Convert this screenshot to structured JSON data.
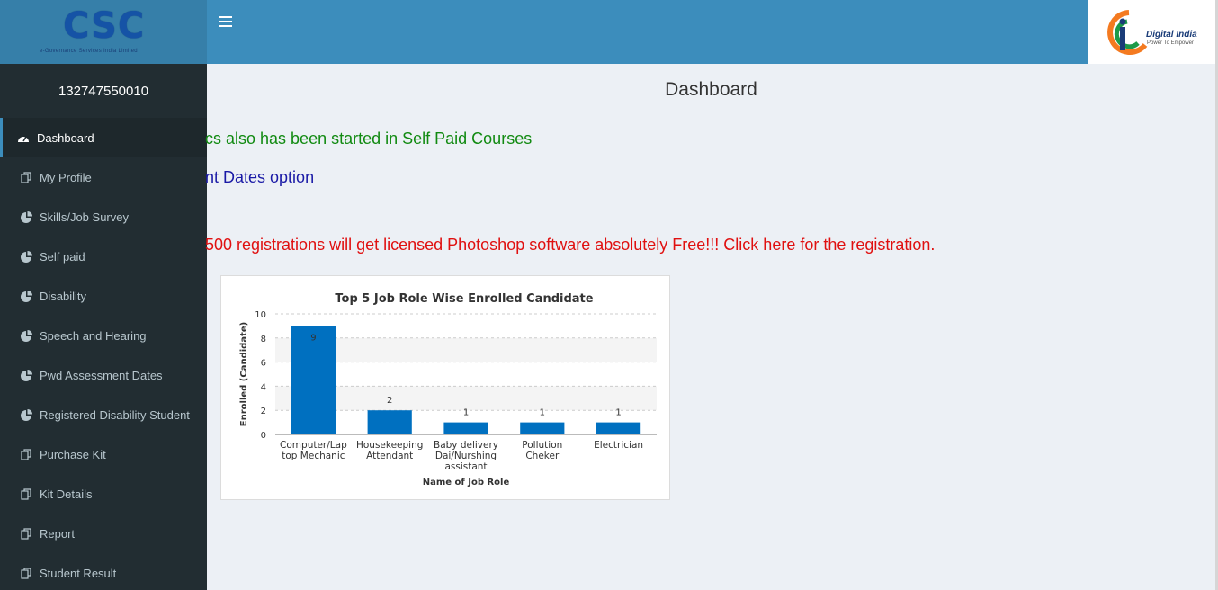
{
  "header": {
    "logo_text": "CSC",
    "logo_subtext": "e-Governance Services India Limited",
    "brand_right_title": "Digital India",
    "brand_right_tagline": "Power To Empower"
  },
  "sidebar": {
    "user_id": "132747550010",
    "items": [
      {
        "label": "Dashboard",
        "icon": "dashboard-icon"
      },
      {
        "label": "My Profile",
        "icon": "copy-icon"
      },
      {
        "label": "Skills/Job Survey",
        "icon": "pie-chart-icon"
      },
      {
        "label": "Self paid",
        "icon": "pie-chart-icon"
      },
      {
        "label": "Disability",
        "icon": "pie-chart-icon"
      },
      {
        "label": "Speech and Hearing",
        "icon": "pie-chart-icon"
      },
      {
        "label": "Pwd Assessment Dates",
        "icon": "pie-chart-icon"
      },
      {
        "label": "Registered Disability Student",
        "icon": "pie-chart-icon"
      },
      {
        "label": "Purchase Kit",
        "icon": "copy-icon"
      },
      {
        "label": "Kit Details",
        "icon": "copy-icon"
      },
      {
        "label": "Report",
        "icon": "copy-icon"
      },
      {
        "label": "Student Result",
        "icon": "copy-icon"
      }
    ]
  },
  "main": {
    "title": "Dashboard",
    "notice_1": "cs also has been started in Self Paid Courses",
    "notice_2": "nt Dates option",
    "notice_3": "500 registrations will get licensed Photoshop software absolutely Free!!! Click here for the registration.",
    "colors": {
      "green": "#118a11",
      "blue": "#1a1aa6",
      "red": "#e01010"
    }
  },
  "chart_data": {
    "type": "bar",
    "title": "Top 5 Job Role Wise Enrolled Candidate",
    "xlabel": "Name of Job Role",
    "ylabel": "Enrolled (Candidate)",
    "categories": [
      [
        "Computer/Lap",
        "top Mechanic"
      ],
      [
        "Housekeeping",
        "Attendant"
      ],
      [
        "Baby delivery",
        "Dai/Nurshing",
        "assistant"
      ],
      [
        "Pollution",
        "Cheker"
      ],
      [
        "Electrician"
      ]
    ],
    "values": [
      9,
      2,
      1,
      1,
      1
    ],
    "ylim": [
      0,
      10
    ],
    "yticks": [
      0,
      2,
      4,
      6,
      8,
      10
    ],
    "bar_color": "#0070c0",
    "grid": true
  }
}
